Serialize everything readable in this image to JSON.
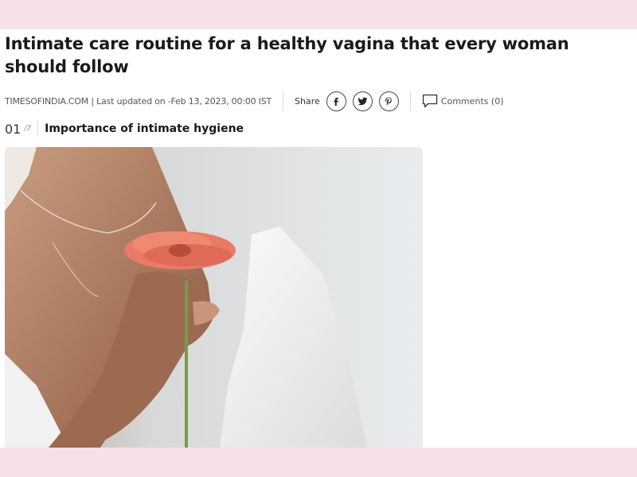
{
  "article": {
    "headline": "Intimate care routine for a healthy vagina that every woman should follow",
    "byline": "TIMESOFINDIA.COM | Last updated on -Feb 13, 2023, 00:00 IST"
  },
  "share": {
    "label": "Share",
    "buttons": [
      {
        "name": "facebook",
        "icon": "facebook-icon"
      },
      {
        "name": "twitter",
        "icon": "twitter-icon"
      },
      {
        "name": "pinterest",
        "icon": "pinterest-icon"
      }
    ]
  },
  "comments": {
    "label": "Comments (0)",
    "icon": "comment-icon"
  },
  "slide": {
    "current": "01",
    "total": "/7",
    "title": "Importance of intimate hygiene"
  },
  "image": {
    "description_icon": "woman-holding-pink-gerbera-photo"
  },
  "colors": {
    "band": "#f6e1ea",
    "text": "#1a1a1a",
    "muted": "#555555"
  }
}
